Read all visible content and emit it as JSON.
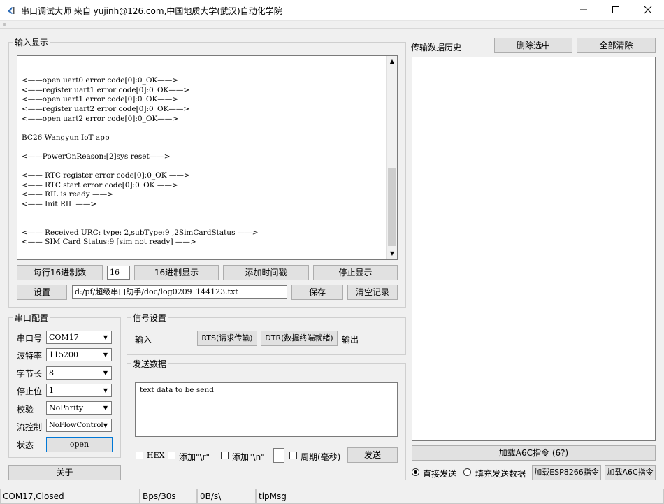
{
  "window": {
    "title": "串口调试大师 来自 yujinh@126.com,中国地质大学(武汉)自动化学院",
    "toolbar_hint": "ıı"
  },
  "input_display": {
    "legend": "输入显示",
    "log_lines": [
      "",
      "",
      "<——open uart0 error code[0]:0_OK——>",
      "<——register uart1 error code[0]:0_OK——>",
      "<——open uart1 error code[0]:0_OK——>",
      "<——register uart2 error code[0]:0_OK——>",
      "<——open uart2 error code[0]:0_OK——>",
      "",
      "BC26 Wangyun IoT app",
      "",
      "<——PowerOnReason:[2]sys reset——>",
      "",
      "<—— RTC register error code[0]:0_OK ——>",
      "<—— RTC start error code[0]:0_OK ——>",
      "<—— RIL is ready ——>",
      "<—— Init RIL ——>",
      "",
      "",
      "<—— Received URC: type: 2,subType:9 ,2SimCardStatus ——>",
      "<—— SIM Card Status:9 [sim not ready] ——>"
    ],
    "hex_per_line_button": "每行16进制数",
    "hex_per_line_value": "16",
    "hex_display_button": "16进制显示",
    "add_timestamp_button": "添加时间戳",
    "stop_display_button": "停止显示",
    "settings_button": "设置",
    "log_path": "d:/pf/超级串口助手/doc/log0209_144123.txt",
    "save_button": "保存",
    "clear_log_button": "清空记录"
  },
  "serial_config": {
    "legend": "串口配置",
    "port_label": "串口号",
    "port_value": "COM17",
    "baud_label": "波特率",
    "baud_value": "115200",
    "databits_label": "字节长",
    "databits_value": "8",
    "stopbits_label": "停止位",
    "stopbits_value": "1",
    "parity_label": "校验",
    "parity_value": "NoParity",
    "flow_label": "流控制",
    "flow_value": "NoFlowControl",
    "state_label": "状态",
    "open_button": "open",
    "about_button": "关于"
  },
  "signal": {
    "legend": "信号设置",
    "input_label": "输入",
    "rts_button": "RTS(请求传输)",
    "dtr_button": "DTR(数据终端就绪)",
    "output_label": "输出"
  },
  "send": {
    "legend": "发送数据",
    "text": "text data to be send",
    "hex_label": "HEX",
    "add_r_label": "添加\"\\r\"",
    "add_n_label": "添加\"\\n\"",
    "period_label": "周期(毫秒)",
    "send_button": "发送"
  },
  "history": {
    "title": "传输数据历史",
    "delete_selected_button": "删除选中",
    "clear_all_button": "全部清除",
    "load_a6c_wide_button": "加载A6C指令 (6?)",
    "direct_send_label": "直接发送",
    "fill_send_label": "填充发送数据",
    "load_esp_button": "加载ESP8266指令",
    "load_a6c_button": "加载A6C指令"
  },
  "statusbar": {
    "port_status": "COM17,Closed",
    "bps": "Bps/30s",
    "rate": "0B/s\\",
    "tip": "tipMsg"
  }
}
